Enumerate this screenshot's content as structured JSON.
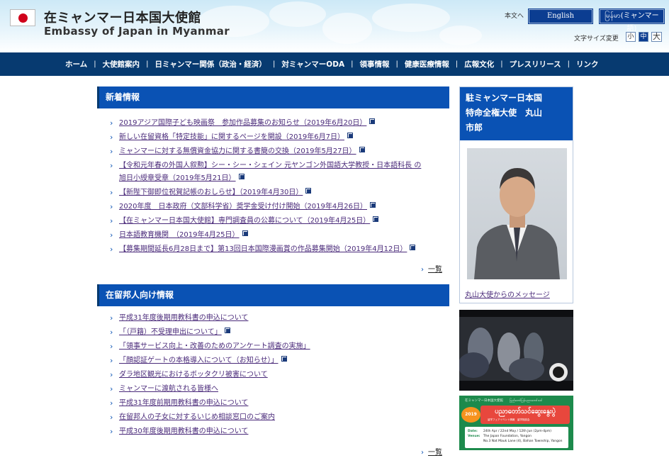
{
  "header": {
    "title_ja": "在ミャンマー日本国大使館",
    "title_en": "Embassy of Japan in Myanmar",
    "skip_link": "本文へ",
    "lang_en": "English",
    "lang_mm": "မြန်မာ(ミャンマー語)",
    "font_size_label": "文字サイズ変更",
    "font_small": "小",
    "font_medium": "中",
    "font_large": "大"
  },
  "nav": {
    "items": [
      {
        "label": "ホーム"
      },
      {
        "label": "大使館案内"
      },
      {
        "label": "日ミャンマー関係（政治・経済）"
      },
      {
        "label": "対ミャンマーODA"
      },
      {
        "label": "領事情報"
      },
      {
        "label": "健康医療情報"
      },
      {
        "label": "広報文化"
      },
      {
        "label": "プレスリリース"
      },
      {
        "label": "リンク"
      }
    ],
    "separator": "|"
  },
  "news": {
    "heading": "新着情報",
    "items": [
      {
        "line1": "2019アジア国際子ども映画祭　参加作品募集のお知らせ（2019年6月20日）",
        "line2": ""
      },
      {
        "line1": "新しい在留資格「特定技能」に関するページを開設（2019年6月7日）",
        "line2": ""
      },
      {
        "line1": "ミャンマーに対する無償資金協力に関する書簡の交換（2019年5月27日）",
        "line2": ""
      },
      {
        "line1": "【令和元年春の外国人叙勲】シー・シー・シェイン 元ヤンゴン外国語大学教授・日本語科長 の",
        "line2": "旭日小綬章受章（2019年5月21日）"
      },
      {
        "line1": "【新陛下御即位祝賀記帳のおしらせ】（2019年4月30日）",
        "line2": ""
      },
      {
        "line1": "2020年度　日本政府（文部科学省）奨学金受け付け開始（2019年4月26日）",
        "line2": ""
      },
      {
        "line1": "【在ミャンマー日本国大使館】専門調査員の公募について（2019年4月25日）",
        "line2": ""
      },
      {
        "line1": "日本語教育機関　（2019年4月25日）",
        "line2": ""
      },
      {
        "line1": "【募集期間延長6月28日まで】第13回日本国際漫画賞の作品募集開始（2019年4月12日）",
        "line2": ""
      }
    ],
    "more": "一覧"
  },
  "residents": {
    "heading": "在留邦人向け情報",
    "items": [
      {
        "label": "平成31年度後期用教科書の申込について",
        "ext": false
      },
      {
        "label": "「（戸籍）不受理申出について」",
        "ext": true
      },
      {
        "label": "「領事サービス向上・改善のためのアンケート調査の実施」",
        "ext": false
      },
      {
        "label": "「顔認証ゲートの本格導入について（お知らせ）」",
        "ext": true
      },
      {
        "label": "ダラ地区観光におけるボッタクリ被害について",
        "ext": false
      },
      {
        "label": "ミャンマーに渡航される皆様へ",
        "ext": false
      },
      {
        "label": "平成31年度前期用教科書の申込について",
        "ext": false
      },
      {
        "label": "在留邦人の子女に対するいじめ相談窓口のご案内",
        "ext": false
      },
      {
        "label": "平成30年度後期用教科書の申込について",
        "ext": false
      }
    ],
    "more": "一覧"
  },
  "ambassador": {
    "title_line1": "駐ミャンマー日本国",
    "title_line2": "特命全権大使　丸山",
    "title_line3": "市郎",
    "caption": "丸山大使からのメッセージ"
  },
  "banner": {
    "top_text": "在ミャンマー日本国大使館　　ပြည်တော်ပြန်ပညာတော်သင်",
    "badge": "2019",
    "title_mm": "ပညာတော်သင်ဆွေးနွေးပွဲ",
    "subtitle": "留学フェアイベント情報　留学相談会",
    "date_label": "Date:",
    "date_value": "24th Apr / 22nd May / 12th Jun (2pm-4pm)",
    "venue_label": "Venue:",
    "venue_value": "The Japan Foundation, Yangon",
    "venue_address": "No.3 Nat Mauk Lane (4), Bahan Township, Yangon"
  },
  "colors": {
    "nav_bg": "#073a70",
    "section_head": "#0a52b4",
    "link": "#4a2a7a",
    "banner_green": "#1d8a4c"
  }
}
